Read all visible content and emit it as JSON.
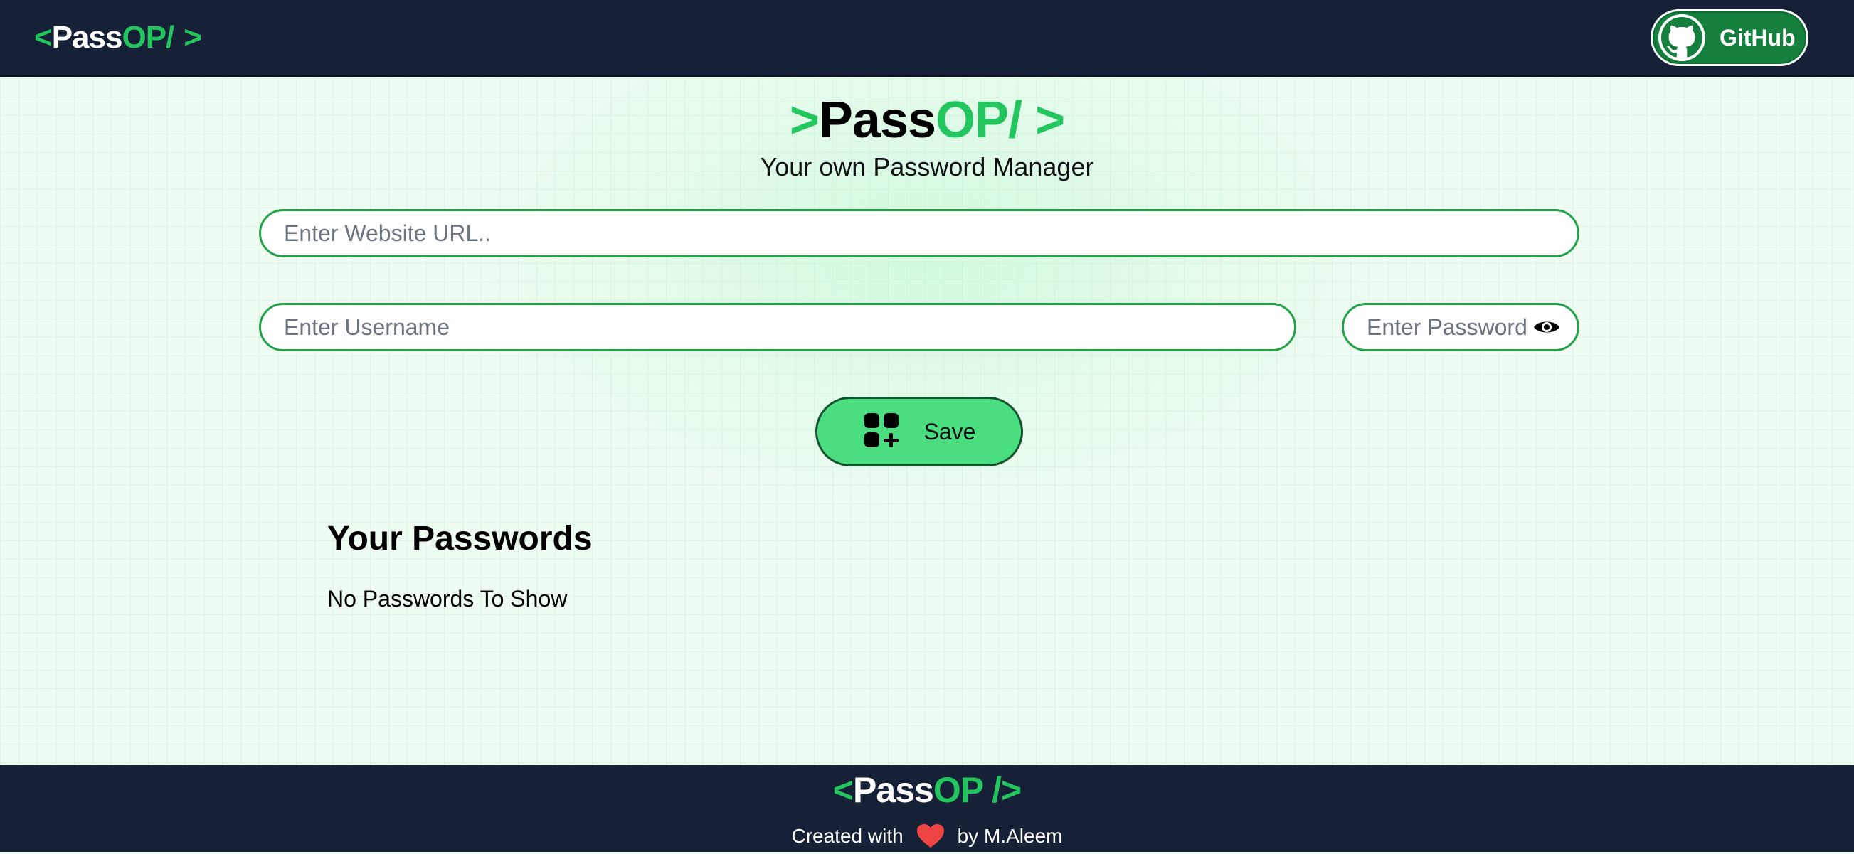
{
  "navbar": {
    "logo": {
      "open": "<",
      "pass": "Pass",
      "op": "OP/",
      "close": ">"
    },
    "github_label": "GitHub"
  },
  "header": {
    "logo": {
      "open": ">",
      "pass": "Pass",
      "op": "OP/",
      "close": ">"
    },
    "subtitle": "Your own Password Manager"
  },
  "form": {
    "url_placeholder": "Enter Website URL..",
    "url_value": "",
    "username_placeholder": "Enter Username",
    "username_value": "",
    "password_placeholder": "Enter Password",
    "password_value": "",
    "save_label": "Save",
    "eye_icon": "eye-icon",
    "save_icon": "add-grid-icon"
  },
  "passwords": {
    "heading": "Your Passwords",
    "empty_message": "No Passwords To Show"
  },
  "footer": {
    "logo": {
      "open": "<",
      "pass": "Pass",
      "op": "OP",
      "close": "/>"
    },
    "created_with": "Created with",
    "by": "by M.Aleem",
    "heart_icon": "heart-icon"
  },
  "colors": {
    "navy": "#162036",
    "brand_green": "#22c55e",
    "save_button": "#4ade80",
    "github_button": "#15803d",
    "input_border": "#22a34a",
    "heart": "#ef4444"
  }
}
